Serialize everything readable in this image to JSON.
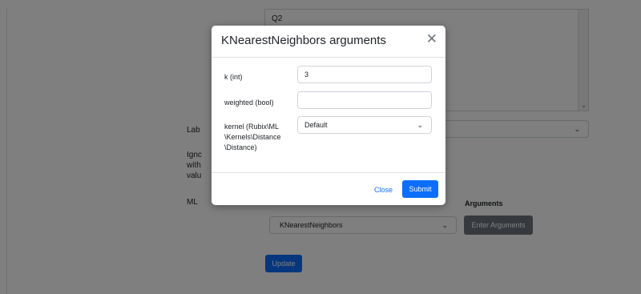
{
  "background": {
    "list_option": "Q2",
    "labels": {
      "label_col": "Lab",
      "ignore_line1": "Ignc",
      "ignore_line2": "with",
      "ignore_line3": "valu",
      "ml": "ML"
    },
    "arguments_header": "Arguments",
    "model_select": "KNearestNeighbors",
    "enter_arguments": "Enter Arguments",
    "update": "Update"
  },
  "modal": {
    "title": "KNearestNeighbors arguments",
    "fields": {
      "k_label": "k (int)",
      "k_value": "3",
      "weighted_label": "weighted (bool)",
      "weighted_value": "",
      "kernel_label_1": "kernel (Rubix\\ML",
      "kernel_label_2": "\\Kernels\\Distance",
      "kernel_label_3": "\\Distance)",
      "kernel_value": "Default"
    },
    "close": "Close",
    "submit": "Submit"
  },
  "colors": {
    "primary": "#0d6efd",
    "secondary": "#6c757d",
    "backdrop": "rgba(0,0,0,0.5)"
  }
}
